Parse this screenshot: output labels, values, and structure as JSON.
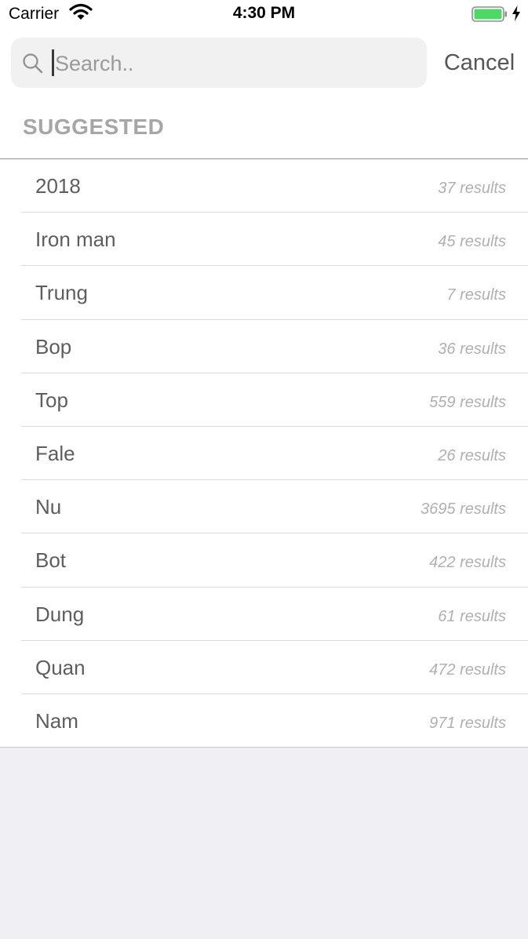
{
  "status_bar": {
    "carrier": "Carrier",
    "time": "4:30 PM",
    "battery_color": "#4cd964"
  },
  "search": {
    "placeholder": "Search..",
    "value": "",
    "cancel_label": "Cancel"
  },
  "section": {
    "title": "SUGGESTED"
  },
  "suggestions": [
    {
      "label": "2018",
      "count": "37 results"
    },
    {
      "label": "Iron man",
      "count": "45 results"
    },
    {
      "label": "Trung",
      "count": "7 results"
    },
    {
      "label": "Bop",
      "count": "36 results"
    },
    {
      "label": "Top",
      "count": "559 results"
    },
    {
      "label": "Fale",
      "count": "26 results"
    },
    {
      "label": "Nu",
      "count": "3695 results"
    },
    {
      "label": "Bot",
      "count": "422 results"
    },
    {
      "label": "Dung",
      "count": "61 results"
    },
    {
      "label": "Quan",
      "count": "472 results"
    },
    {
      "label": "Nam",
      "count": "971 results"
    }
  ]
}
